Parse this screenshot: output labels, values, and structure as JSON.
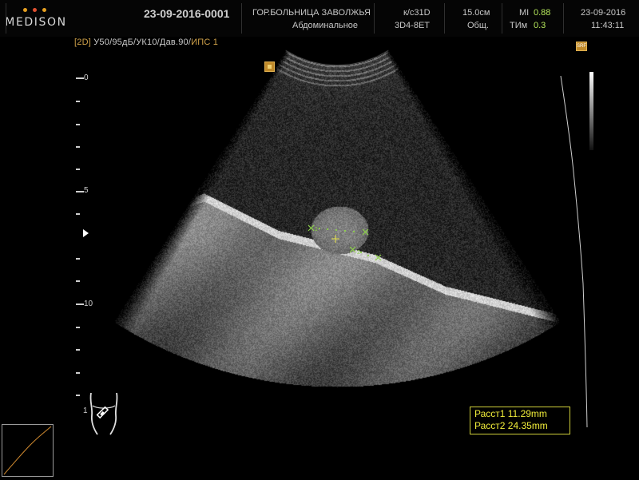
{
  "header": {
    "brand": "MEDISON",
    "patient_id": "23-09-2016-0001",
    "hospital": "ГОР.БОЛЬНИЦА ЗАВОЛЖЬЯ",
    "exam": "Абдоминальное",
    "probe_top": "к/с31D",
    "probe_bottom": "3D4-8ET",
    "depth": "15.0см",
    "preset": "Общ.",
    "mi_label": "MI",
    "mi_value": "0.88",
    "tim_label": "ТИм",
    "tim_value": "0.3",
    "date": "23-09-2016",
    "time": "11:43:11"
  },
  "params": {
    "mode": "[2D]",
    "settings": " У50/95дБ/УК10/Дав.90/",
    "ips": "ИПС 1"
  },
  "ruler": {
    "label_0": "0",
    "label_5": "5",
    "label_10": "10"
  },
  "srf_marker": "SRF",
  "body_mark_number": "1",
  "measurements": {
    "line1": "Расст1 11.29mm",
    "line2": "Расст2 24.35mm"
  },
  "colors": {
    "header_text": "#cfcfcf",
    "value_green": "#b6e85c",
    "params_orange": "#d0a24a",
    "measure_yellow": "#f2ee3a",
    "caliper_green": "#8ed24a",
    "logo_dot_1": "#e6a020",
    "logo_dot_2": "#e05030",
    "logo_dot_3": "#e6a020"
  }
}
